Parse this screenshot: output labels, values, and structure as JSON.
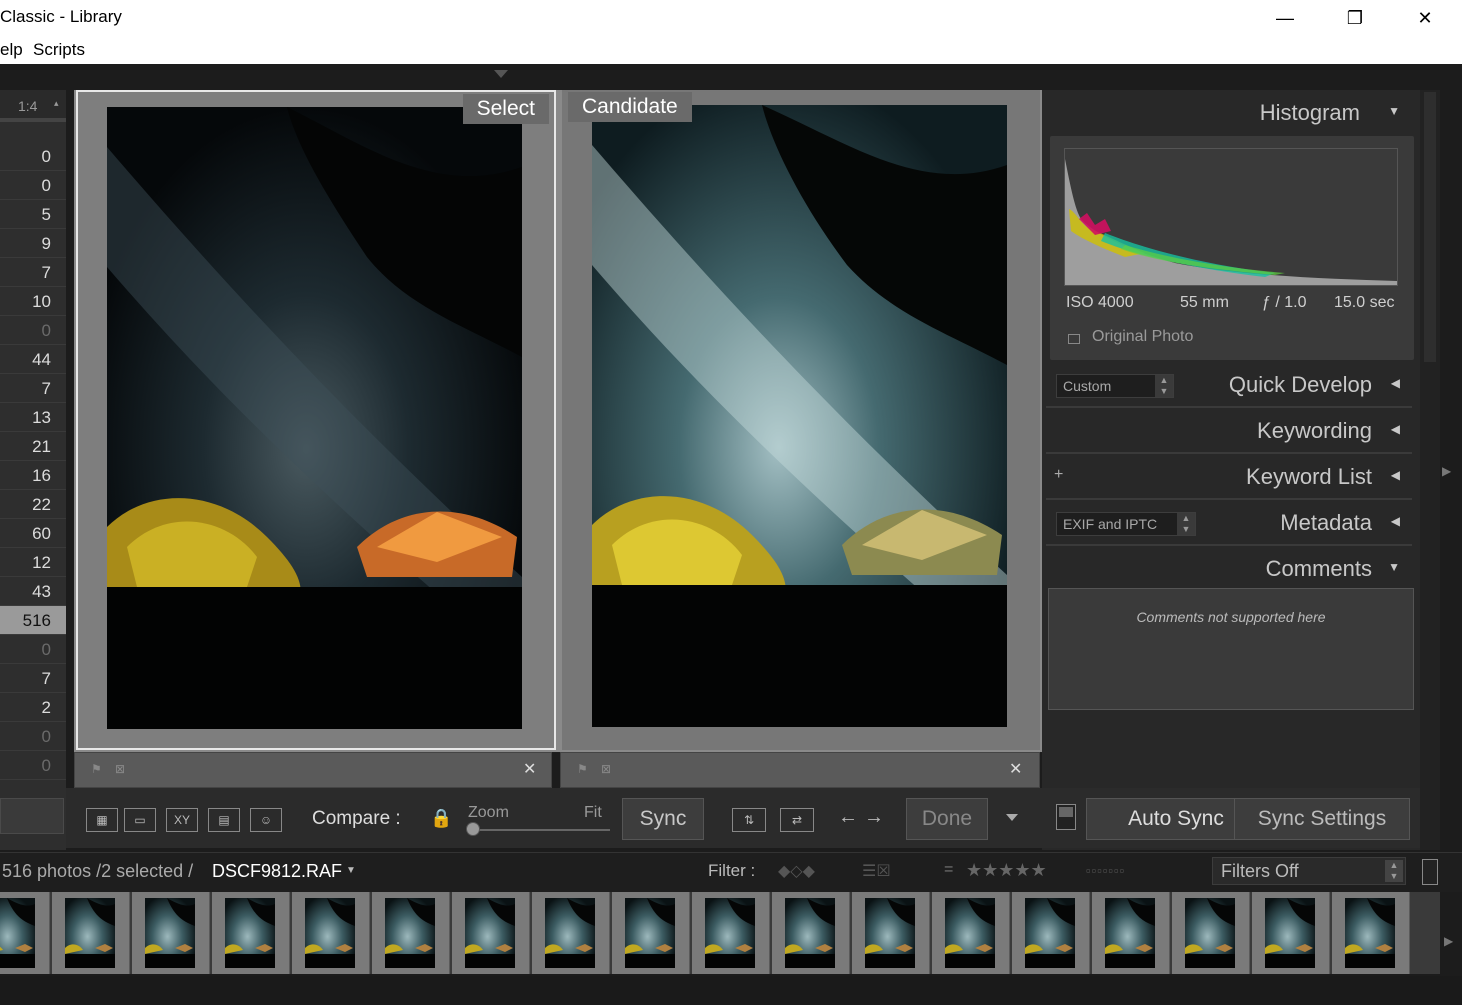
{
  "window": {
    "title": "Classic - Library",
    "minimize": "—",
    "restore": "❐",
    "close": "✕"
  },
  "menu": {
    "items": [
      "elp",
      "Scripts"
    ]
  },
  "left_panel": {
    "zoom_value": "1:4",
    "counts": [
      "0",
      "0",
      "5",
      "9",
      "7",
      "10",
      "0",
      "44",
      "7",
      "13",
      "21",
      "16",
      "22",
      "60",
      "12",
      "43",
      "516",
      "0",
      "7",
      "2",
      "0",
      "0"
    ],
    "dim_indices": [
      6,
      17,
      20,
      21
    ],
    "selected_index": 16
  },
  "compare": {
    "select_label": "Select",
    "candidate_label": "Candidate"
  },
  "toolbar": {
    "compare_label": "Compare :",
    "zoom_label": "Zoom",
    "fit_label": "Fit",
    "sync_label": "Sync",
    "done_label": "Done",
    "xy_label": "XY"
  },
  "histogram": {
    "title": "Histogram",
    "iso": "ISO 4000",
    "focal": "55 mm",
    "aperture": "ƒ / 1.0",
    "shutter": "15.0 sec",
    "original_photo": "Original Photo"
  },
  "panels": {
    "quick_develop": "Quick Develop",
    "quick_develop_preset": "Custom",
    "keywording": "Keywording",
    "keyword_list": "Keyword List",
    "keyword_add": "+",
    "metadata": "Metadata",
    "metadata_preset": "EXIF and IPTC",
    "comments": "Comments",
    "comments_note": "Comments not supported here"
  },
  "right_bottom": {
    "auto_sync": "Auto Sync",
    "sync_settings": "Sync Settings"
  },
  "filmstrip": {
    "status_prefix": "516 photos /2 selected /",
    "filename": "DSCF9812.RAF",
    "filter_label": "Filter :",
    "filters_off": "Filters Off",
    "stars": "★★★★★",
    "thumb_count": 18
  },
  "colors": {
    "panel_bg": "#282828",
    "text": "#c8c8c8"
  }
}
